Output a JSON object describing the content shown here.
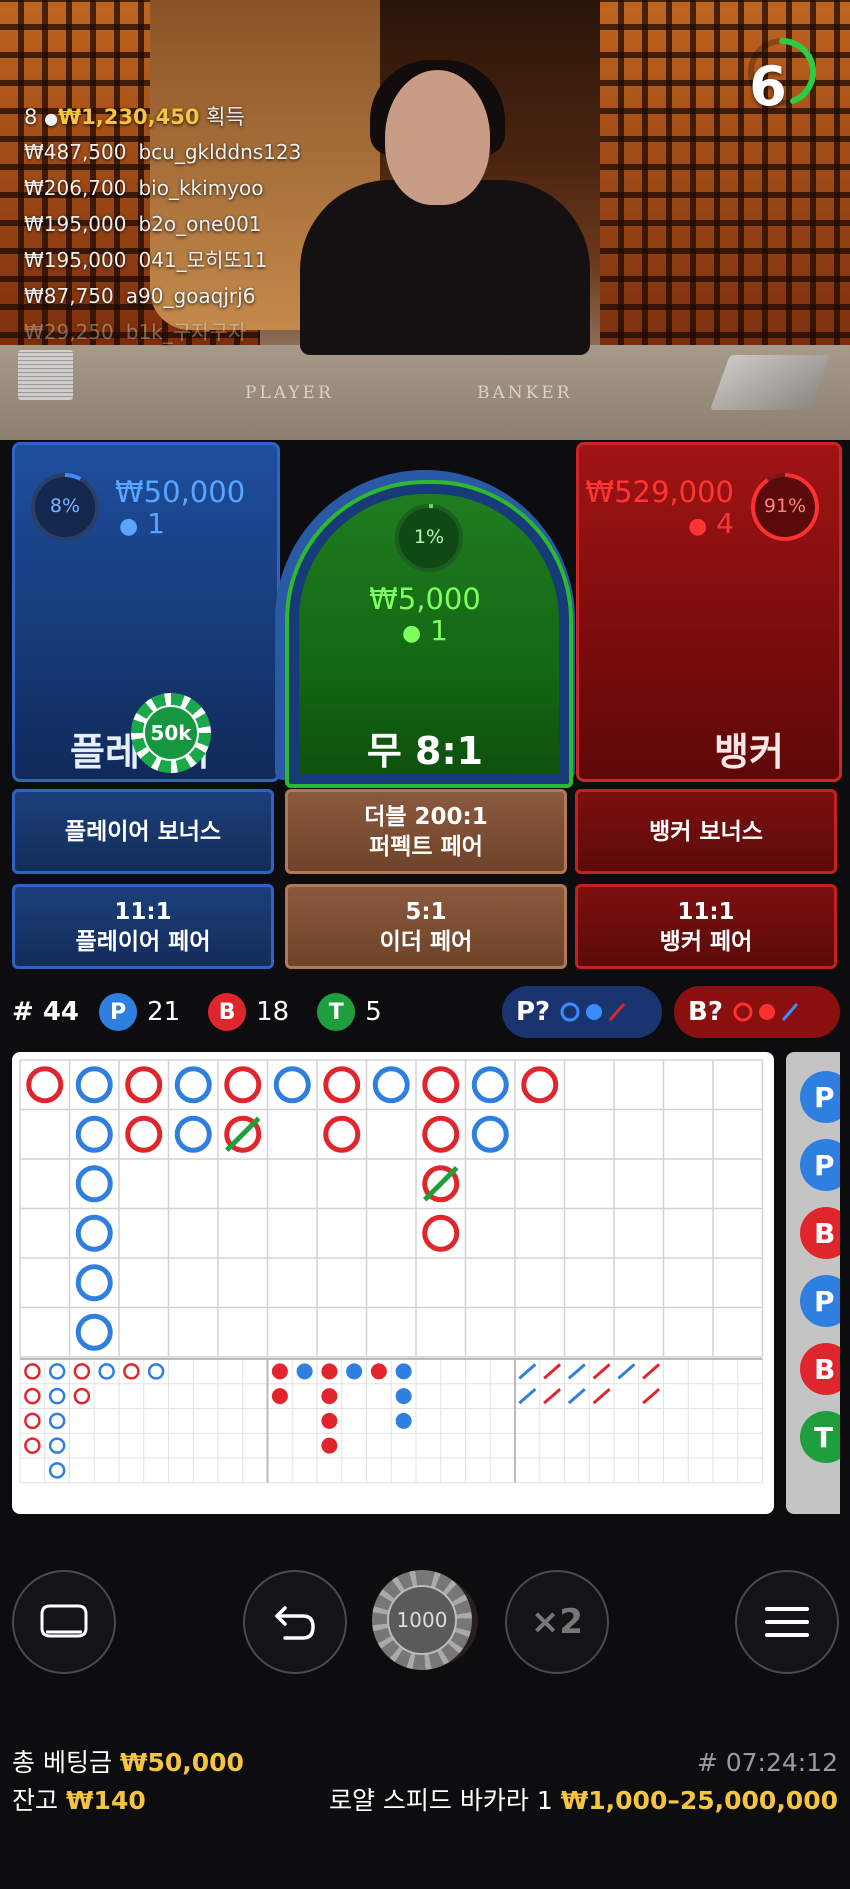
{
  "timer": {
    "value": "6",
    "ring_color": "#2ecc40"
  },
  "winners": {
    "count": "8",
    "total": "₩1,230,450",
    "suffix": "획득",
    "list": [
      {
        "amount": "₩487,500",
        "user": "bcu_gklddns123"
      },
      {
        "amount": "₩206,700",
        "user": "bio_kkimyoo"
      },
      {
        "amount": "₩195,000",
        "user": "b2o_one001"
      },
      {
        "amount": "₩195,000",
        "user": "041_모히또11"
      },
      {
        "amount": "₩87,750",
        "user": "a90_goaqjrj6"
      },
      {
        "amount": "₩29,250",
        "user": "b1k_구자구자"
      }
    ]
  },
  "felt": {
    "player": "PLAYER",
    "banker": "BANKER"
  },
  "bets": {
    "player": {
      "percent": "8%",
      "percent_value": 0.08,
      "amount": "₩50,000",
      "players": "1",
      "label": "플레이어",
      "chip": "50k"
    },
    "tie": {
      "percent": "1%",
      "percent_value": 0.01,
      "amount": "₩5,000",
      "players": "1",
      "label": "무 8:1"
    },
    "banker": {
      "percent": "91%",
      "percent_value": 0.91,
      "amount": "₩529,000",
      "players": "4",
      "label": "뱅커"
    }
  },
  "side_bets": {
    "player_bonus": "플레이어 보너스",
    "perfect_pair_line1": "더블 200:1",
    "perfect_pair_line2": "퍼펙트 페어",
    "banker_bonus": "뱅커 보너스",
    "player_pair_line1": "11:1",
    "player_pair_line2": "플레이어 페어",
    "either_pair_line1": "5:1",
    "either_pair_line2": "이더 페어",
    "banker_pair_line1": "11:1",
    "banker_pair_line2": "뱅커 페어"
  },
  "stats": {
    "round_label": "# 44",
    "p_label": "P",
    "p_count": "21",
    "b_label": "B",
    "b_count": "18",
    "t_label": "T",
    "t_count": "5",
    "predict_player": "P?",
    "predict_banker": "B?"
  },
  "controls": {
    "chip_value": "1000",
    "double_label": "×2"
  },
  "footer": {
    "total_bet_label": "총 베팅금",
    "total_bet_value": "₩50,000",
    "balance_label": "잔고",
    "balance_value": "₩140",
    "game_id": "# 07:24:12",
    "table_name": "로얄 스피드 바카라 1",
    "limits": "₩1,000–25,000,000"
  },
  "colors": {
    "player": "#2f7fe0",
    "banker": "#e0262c",
    "tie": "#1e9e3c",
    "gold": "#f5c542"
  },
  "roadmap": {
    "bead": [
      [
        "B",
        "P",
        "B",
        "P",
        "B",
        "P",
        "B",
        "P",
        "B",
        "P",
        "B"
      ],
      [
        "",
        "P",
        "B",
        "P",
        "BT",
        "",
        "B",
        "",
        "B",
        "P",
        ""
      ],
      [
        "",
        "P",
        "",
        "",
        "",
        "",
        "",
        "",
        "BT",
        "",
        ""
      ],
      [
        "",
        "P",
        "",
        "",
        "",
        "",
        "",
        "",
        "B",
        "",
        ""
      ],
      [
        "",
        "P",
        "",
        "",
        "",
        "",
        "",
        "",
        "",
        "",
        ""
      ],
      [
        "",
        "P",
        "",
        "",
        "",
        "",
        "",
        "",
        "",
        "",
        ""
      ]
    ],
    "side": [
      "P",
      "P",
      "B",
      "P",
      "B",
      "T"
    ]
  }
}
